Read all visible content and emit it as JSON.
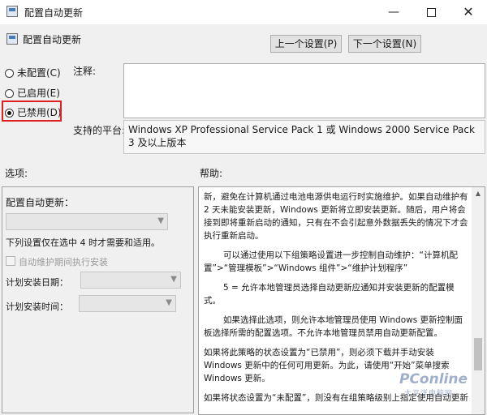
{
  "window": {
    "title": "配置自动更新",
    "minimize_glyph": "—",
    "close_glyph": "✕"
  },
  "header": {
    "title": "配置自动更新",
    "prev_button": "上一个设置(P)",
    "next_button": "下一个设置(N)"
  },
  "state_options": [
    {
      "label": "未配置(C)",
      "checked": false
    },
    {
      "label": "已启用(E)",
      "checked": false
    },
    {
      "label": "已禁用(D)",
      "checked": true
    }
  ],
  "comment": {
    "label": "注释:",
    "value": ""
  },
  "supported_on": {
    "label": "支持的平台:",
    "value": "Windows XP Professional Service Pack 1 或 Windows 2000 Service Pack 3 及以上版本"
  },
  "options": {
    "section_label": "选项:",
    "configure_label": "配置自动更新：",
    "note": "下列设置仅在选中 4 时才需要和适用。",
    "maintenance_checkbox": "自动维护期间执行安装",
    "day_label": "计划安装日期：",
    "time_label": "计划安装时间："
  },
  "help": {
    "section_label": "帮助:",
    "paragraphs": [
      "新，避免在计算机通过电池电源供电运行时实施维护。如果自动维护有 2 天未能安装更新，Windows 更新将立即安装更新。随后，用户将会接到即将重新启动的通知，只有在不会引起意外数据丢失的情况下才会执行重新启动。",
      "可以通过使用以下组策略设置进一步控制自动维护：“计算机配置”>“管理模板”>“Windows 组件”>“维护计划程序”",
      "5 = 允许本地管理员选择自动更新应通知并安装更新的配置模式。",
      "如果选择此选项，则允许本地管理员使用 Windows 更新控制面板选择所需的配置选项。不允许本地管理员禁用自动更新配置。",
      "如果将此策略的状态设置为“已禁用”，则必须下载并手动安装 Windows 更新中的任何可用更新。为此，请使用“开始”菜单搜索 Windows 更新。",
      "如果将状态设置为“未配置”，则没有在组策略级别上指定使用自动更新"
    ]
  },
  "watermark": {
    "main": "PConline",
    "sub": "太平洋电脑网"
  },
  "icons": [
    "policy-icon",
    "radio-icon",
    "chevron-down-icon",
    "checkbox-icon",
    "scroll-up-icon"
  ],
  "colors": {
    "highlight": "#e02020",
    "window_bg": "#f0f0f0"
  }
}
